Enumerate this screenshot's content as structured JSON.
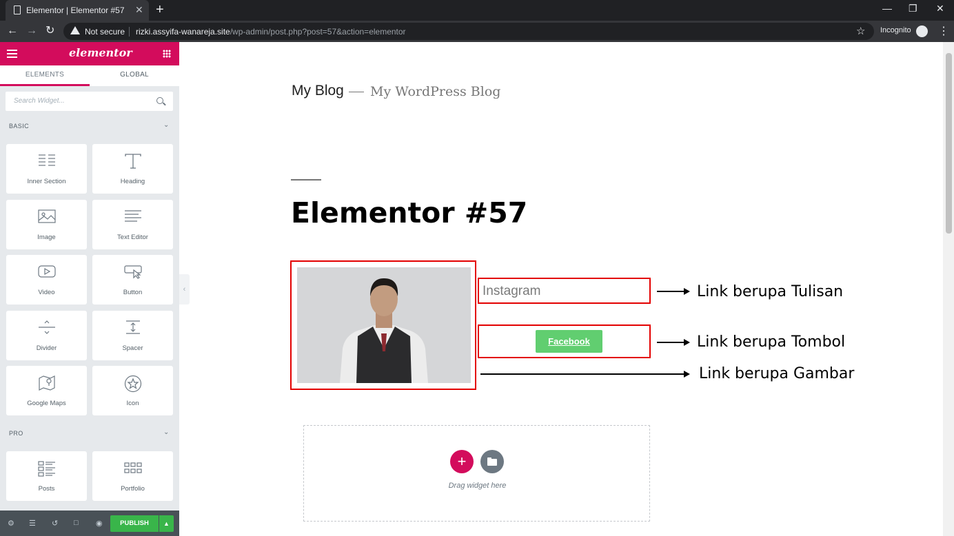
{
  "browser": {
    "tab_title": "Elementor | Elementor #57",
    "close_glyph": "✕",
    "newtab_glyph": "+",
    "security_label": "Not secure",
    "url_host": "rizki.assyifa-wanareja.site",
    "url_path": "/wp-admin/post.php?post=57&action=elementor",
    "profile_label": "Incognito"
  },
  "panel": {
    "logo": "elementor",
    "tabs": [
      {
        "label": "ELEMENTS"
      },
      {
        "label": "GLOBAL"
      }
    ],
    "search_placeholder": "Search Widget...",
    "categories": [
      {
        "label": "BASIC"
      },
      {
        "label": "PRO"
      }
    ],
    "widgets": [
      {
        "label": "Inner Section",
        "icon": "inner-section-icon"
      },
      {
        "label": "Heading",
        "icon": "heading-icon"
      },
      {
        "label": "Image",
        "icon": "image-icon"
      },
      {
        "label": "Text Editor",
        "icon": "text-editor-icon"
      },
      {
        "label": "Video",
        "icon": "video-icon"
      },
      {
        "label": "Button",
        "icon": "button-icon"
      },
      {
        "label": "Divider",
        "icon": "divider-icon"
      },
      {
        "label": "Spacer",
        "icon": "spacer-icon"
      },
      {
        "label": "Google Maps",
        "icon": "google-maps-icon"
      },
      {
        "label": "Icon",
        "icon": "star-icon"
      }
    ],
    "pro_widgets": [
      {
        "label": "Posts",
        "icon": "posts-icon"
      },
      {
        "label": "Portfolio",
        "icon": "portfolio-icon"
      }
    ],
    "publish_label": "PUBLISH",
    "accent": "#d30c5c",
    "publish_color": "#39b54a"
  },
  "page": {
    "site_title": "My Blog",
    "site_tagline": "My WordPress Blog",
    "post_title": "Elementor #57",
    "instagram_link": "Instagram",
    "facebook_button": "Facebook",
    "button_color": "#61ce70",
    "drop_hint": "Drag widget here",
    "add_glyph": "+"
  },
  "annotations": [
    {
      "text": "Link berupa Tulisan"
    },
    {
      "text": "Link berupa Tombol"
    },
    {
      "text": "Link berupa Gambar"
    }
  ],
  "annotation_color": "#e30000"
}
